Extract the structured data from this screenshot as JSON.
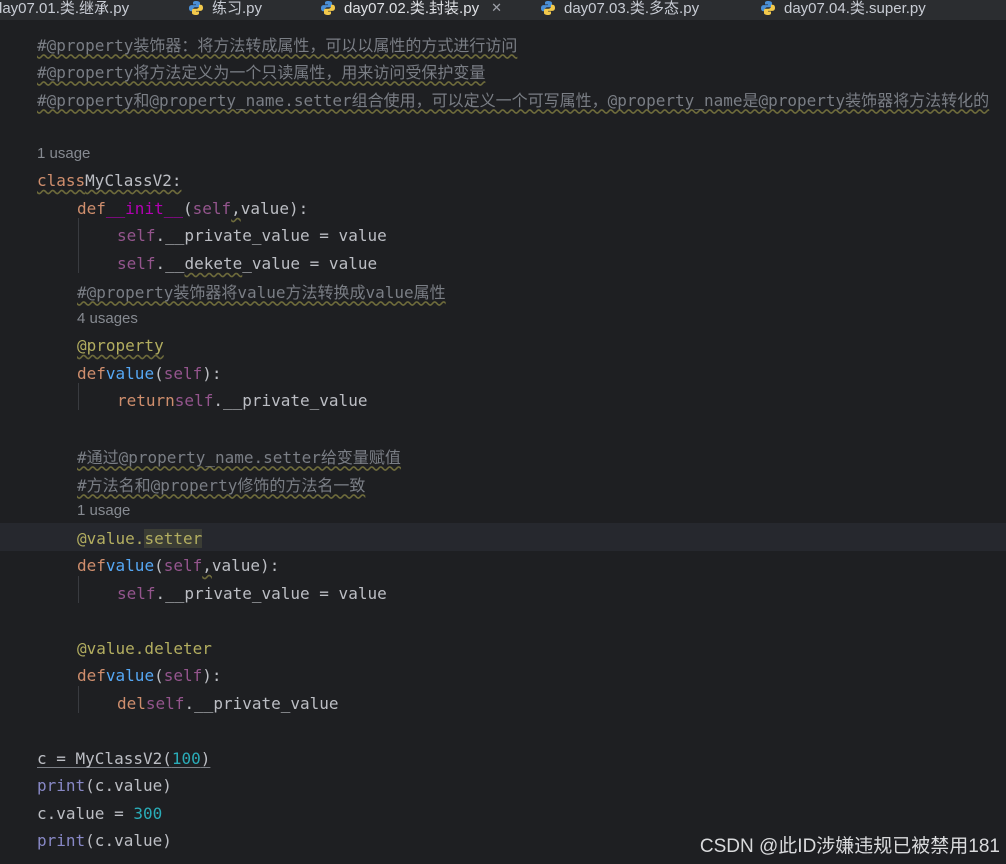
{
  "tabs": [
    {
      "label": "day07.01.类.继承.py",
      "active": false
    },
    {
      "label": "练习.py",
      "active": false
    },
    {
      "label": "day07.02.类.封装.py",
      "active": true
    },
    {
      "label": "day07.03.类.多态.py",
      "active": false
    },
    {
      "label": "day07.04.类.super.py",
      "active": false
    }
  ],
  "code": {
    "l1": "#@property装饰器：将方法转成属性，可以以属性的方式进行访问",
    "l2": "#@property将方法定义为一个只读属性，用来访问受保护变量",
    "l3": "#@property和@property_name.setter组合使用，可以定义一个可写属性，@property_name是@property装饰器将方法转化的",
    "u1": "1 usage",
    "l5": {
      "kw": "class",
      "name": "MyClassV2:"
    },
    "l6": {
      "kw": "def",
      "name": "__init__",
      "open": "(",
      "self": "self",
      "comma": ",",
      "rest": "value):"
    },
    "l7": {
      "self": "self",
      "rest": ".__private_value = value"
    },
    "l8": {
      "self": "self",
      "a": ".__",
      "b": "dekete",
      "c": "_value = value"
    },
    "l9": "#@property装饰器将value方法转换成value属性",
    "u2": "4 usages",
    "l10": "@property",
    "l11": {
      "kw": "def",
      "name": "value",
      "open": "(",
      "self": "self",
      "rest": "):"
    },
    "l12": {
      "kw": "return",
      "self": "self",
      "rest": ".__private_value"
    },
    "l13": "#通过@property_name.setter给变量赋值",
    "l14": "#方法名和@property修饰的方法名一致",
    "u3": "1 usage",
    "l15": {
      "a": "@value.",
      "b": "setter"
    },
    "l16": {
      "kw": "def",
      "name": "value",
      "open": "(",
      "self": "self",
      "comma": ",",
      "rest": "value):"
    },
    "l17": {
      "self": "self",
      "rest": ".__private_value = value"
    },
    "l18": "@value.deleter",
    "l19": {
      "kw": "def",
      "name": "value",
      "open": "(",
      "self": "self",
      "rest": "):"
    },
    "l20": {
      "kw": "del",
      "self": "self",
      "rest": ".__private_value"
    },
    "l21": {
      "a": "c = MyClassV2(",
      "num": "100",
      "b": ")"
    },
    "l22": {
      "fn": "print",
      "rest": "(c.value)"
    },
    "l23": {
      "a": "c.value = ",
      "num": "300"
    },
    "l24": {
      "fn": "print",
      "rest": "(c.value)"
    }
  },
  "watermark": "CSDN @此ID涉嫌违规已被禁用181",
  "colors": {
    "background": "#1e1f22",
    "keyword": "#cf8e6d",
    "comment": "#7a7e85",
    "function": "#56a8f5",
    "self": "#94558d",
    "decorator": "#b3ae60",
    "number": "#2aacb8",
    "accent": "#3574f0"
  }
}
